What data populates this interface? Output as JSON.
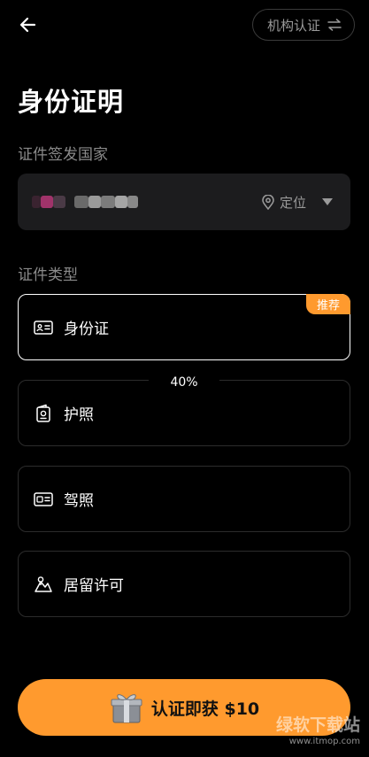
{
  "header": {
    "back_icon": "arrow-left-icon",
    "org_button_label": "机构认证",
    "org_button_icon": "swap-arrows-icon"
  },
  "page_title": "身份证明",
  "country_section": {
    "label": "证件签发国家",
    "locate_label": "定位",
    "locate_icon": "location-pin-icon",
    "dropdown_icon": "triangle-down-icon"
  },
  "doc_type_section": {
    "label": "证件类型",
    "options": [
      {
        "label": "身份证",
        "icon": "id-card-icon",
        "selected": true,
        "badge": "推荐"
      },
      {
        "label": "护照",
        "icon": "passport-icon",
        "selected": false
      },
      {
        "label": "驾照",
        "icon": "driver-license-icon",
        "selected": false
      },
      {
        "label": "居留许可",
        "icon": "residence-permit-icon",
        "selected": false
      }
    ]
  },
  "progress_text": "40%",
  "cta": {
    "label": "认证即获 $10",
    "icon": "gift-box-icon"
  },
  "watermark": {
    "name": "绿软下载站",
    "url": "www.itmop.com"
  },
  "colors": {
    "background": "#000000",
    "accent": "#ff9a2e",
    "field_bg": "#1c1c1e",
    "muted_text": "#8a8a8a"
  }
}
